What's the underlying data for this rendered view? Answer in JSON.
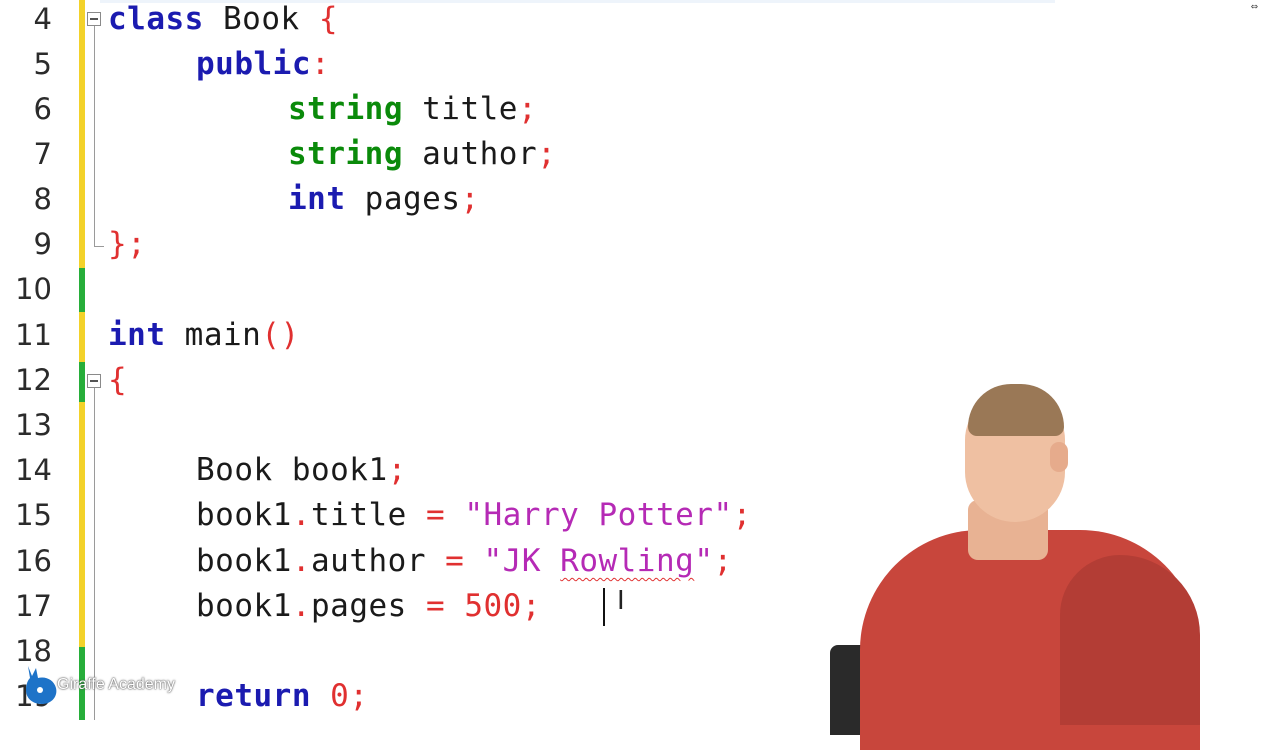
{
  "editor": {
    "lines": [
      {
        "num": "4"
      },
      {
        "num": "5"
      },
      {
        "num": "6"
      },
      {
        "num": "7"
      },
      {
        "num": "8"
      },
      {
        "num": "9"
      },
      {
        "num": "10"
      },
      {
        "num": "11"
      },
      {
        "num": "12"
      },
      {
        "num": "13"
      },
      {
        "num": "14"
      },
      {
        "num": "15"
      },
      {
        "num": "16"
      },
      {
        "num": "17"
      },
      {
        "num": "18"
      },
      {
        "num": "19"
      }
    ],
    "code": {
      "l4_kw": "class",
      "l4_name": " Book ",
      "l4_brace": "{",
      "l5_kw": "public",
      "l5_colon": ":",
      "l6_type": "string",
      "l6_name": " title",
      "l6_semi": ";",
      "l7_type": "string",
      "l7_name": " author",
      "l7_semi": ";",
      "l8_type": "int",
      "l8_name": " pages",
      "l8_semi": ";",
      "l9_close": "};",
      "l11_type": "int",
      "l11_name": " main",
      "l11_parens": "()",
      "l12_open": "{",
      "l14_text": "Book book1",
      "l14_semi": ";",
      "l15_obj": "book1",
      "l15_dot": ".",
      "l15_field": "title ",
      "l15_eq": "=",
      "l15_str": " \"Harry Potter\"",
      "l15_semi": ";",
      "l16_obj": "book1",
      "l16_dot": ".",
      "l16_field": "author ",
      "l16_eq": "=",
      "l16_q1": " \"JK ",
      "l16_sq": "Rowling",
      "l16_q2": "\"",
      "l16_semi": ";",
      "l17_obj": "book1",
      "l17_dot": ".",
      "l17_field": "pages ",
      "l17_eq": "=",
      "l17_num": " 500",
      "l17_semi": ";",
      "l19_kw": "return",
      "l19_num": " 0",
      "l19_semi": ";"
    }
  },
  "cursor": {
    "ibeam": "I"
  },
  "window": {
    "corner_mark": "⇔"
  },
  "watermark": {
    "text": "Giraffe Academy"
  }
}
